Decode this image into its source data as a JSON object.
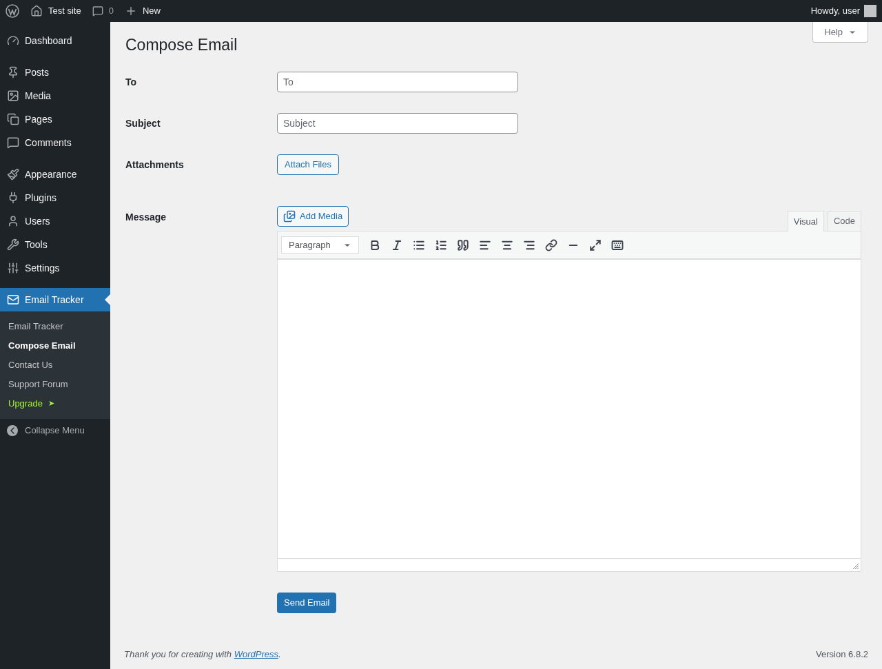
{
  "admin_bar": {
    "site": "Test site",
    "comments": "0",
    "new": "New",
    "greeting": "Howdy, user"
  },
  "sidebar": {
    "sections": [
      {
        "items": [
          {
            "label": "Dashboard",
            "selected": false
          }
        ]
      },
      {
        "items": [
          {
            "label": "Posts",
            "selected": false
          },
          {
            "label": "Media",
            "selected": false
          },
          {
            "label": "Pages",
            "selected": false
          },
          {
            "label": "Comments",
            "selected": false
          }
        ]
      },
      {
        "items": [
          {
            "label": "Appearance",
            "selected": false
          },
          {
            "label": "Plugins",
            "selected": false
          },
          {
            "label": "Users",
            "selected": false
          },
          {
            "label": "Tools",
            "selected": false
          },
          {
            "label": "Settings",
            "selected": false
          }
        ]
      },
      {
        "items": [
          {
            "label": "Email Tracker",
            "selected": true
          }
        ]
      }
    ],
    "submenu": [
      {
        "label": "Email Tracker",
        "selected": false,
        "kind": "link"
      },
      {
        "label": "Compose Email",
        "selected": true,
        "kind": "link"
      },
      {
        "label": "Contact Us",
        "selected": false,
        "kind": "link"
      },
      {
        "label": "Support Forum",
        "selected": false,
        "kind": "link"
      },
      {
        "label": "Upgrade",
        "selected": false,
        "kind": "upgrade",
        "arrow": "➤"
      }
    ],
    "collapse": "Collapse Menu"
  },
  "help": "Help",
  "title": "Compose Email",
  "form": {
    "to": {
      "label": "To",
      "placeholder": "To"
    },
    "subject": {
      "label": "Subject",
      "placeholder": "Subject"
    },
    "attachments": {
      "label": "Attachments",
      "button": "Attach Files"
    },
    "message": {
      "label": "Message",
      "add_media": "Add Media",
      "format": "Paragraph",
      "tabs": [
        {
          "label": "Visual",
          "selected": true
        },
        {
          "label": "Code",
          "selected": false
        }
      ]
    },
    "send": "Send Email"
  },
  "footer": {
    "thanks": "Thank you for creating with ",
    "link": "WordPress",
    "end": ".",
    "version": "Version 6.8.2"
  }
}
